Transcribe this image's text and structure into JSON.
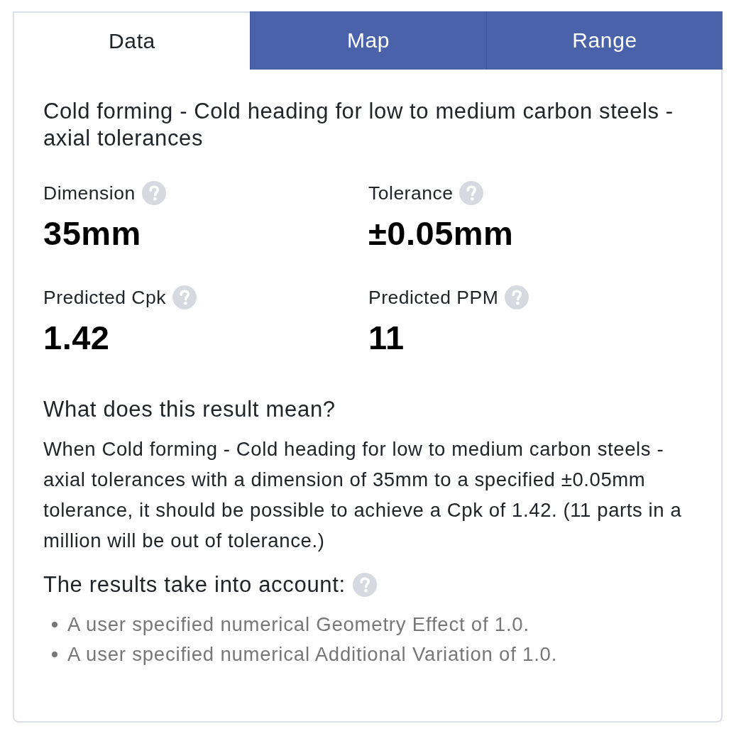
{
  "tabs": [
    {
      "label": "Data",
      "selected": true
    },
    {
      "label": "Map",
      "selected": false
    },
    {
      "label": "Range",
      "selected": false
    }
  ],
  "panel": {
    "title": "Cold forming - Cold heading for low to medium carbon steels - axial tolerances",
    "metrics": [
      {
        "label": "Dimension",
        "value": "35mm"
      },
      {
        "label": "Tolerance",
        "value": "±0.05mm"
      },
      {
        "label": "Predicted Cpk",
        "value": "1.42"
      },
      {
        "label": "Predicted PPM",
        "value": "11"
      }
    ],
    "explanation": {
      "heading": "What does this result mean?",
      "text": "When Cold forming - Cold heading for low to medium carbon steels - axial tolerances with a dimension of 35mm to a specified ±0.05mm tolerance, it should be possible to achieve a Cpk of 1.42. (11 parts in a million will be out of tolerance.)"
    },
    "factors": {
      "heading": "The results take into account:",
      "items": [
        "A user specified numerical Geometry Effect of 1.0.",
        "A user specified numerical Additional Variation of 1.0."
      ]
    }
  }
}
